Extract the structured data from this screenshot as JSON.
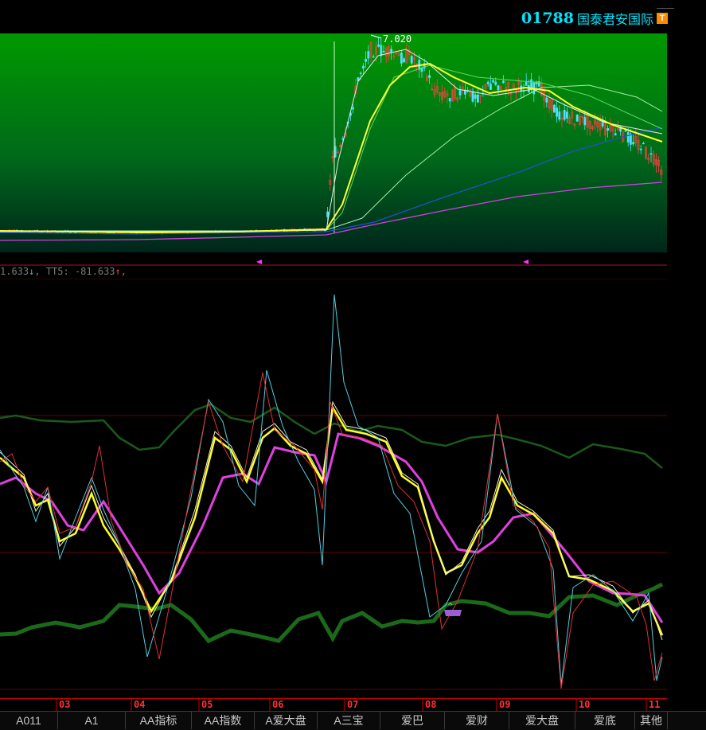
{
  "header": {
    "code": "01788",
    "name": "国泰君安国际",
    "badge": "T"
  },
  "main_chart": {
    "peak_label": "7.020"
  },
  "indicator": {
    "left_value": "1.633",
    "left_arrow": "↓",
    "tt5_label": "TT5:",
    "tt5_value": "-81.633",
    "tt5_arrow": "↑"
  },
  "months": [
    "03",
    "04",
    "05",
    "06",
    "07",
    "08",
    "09",
    "10",
    "11"
  ],
  "tabs": [
    {
      "label": "A011"
    },
    {
      "label": "A1"
    },
    {
      "label": "AA指标"
    },
    {
      "label": "AA指数"
    },
    {
      "label": "A爱大盘"
    },
    {
      "label": "A三宝"
    },
    {
      "label": "爱巴"
    },
    {
      "label": "爱财"
    },
    {
      "label": "爱大盘"
    },
    {
      "label": "爱底"
    },
    {
      "label": "其他"
    }
  ],
  "colors": {
    "code": "#00e5ff",
    "bg_top": "#009900",
    "bg_bottom": "#00251c",
    "axis_red": "#cc0000"
  }
}
